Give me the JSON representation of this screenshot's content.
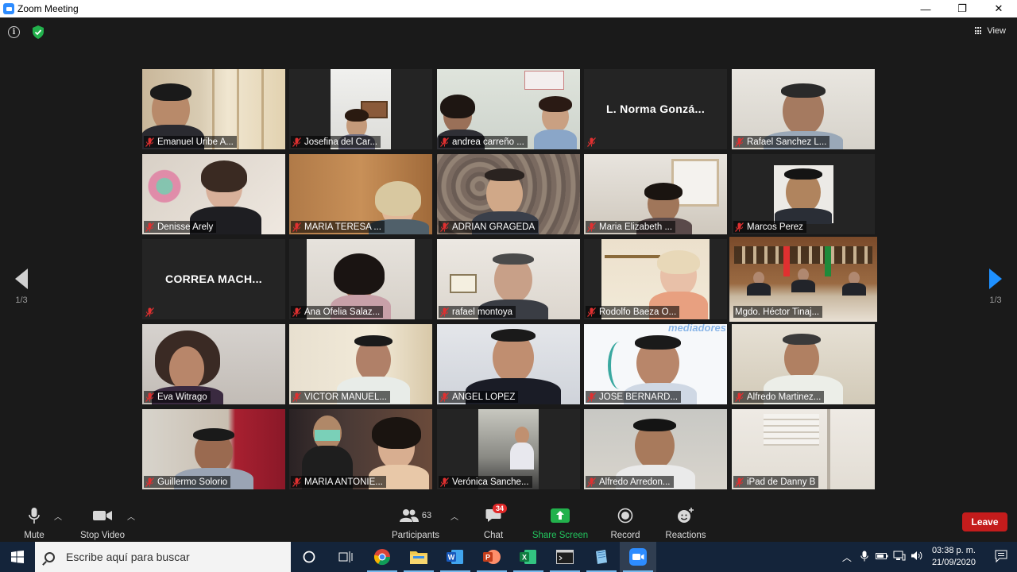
{
  "window": {
    "title": "Zoom Meeting",
    "controls": [
      "—",
      "❐",
      "✕"
    ]
  },
  "meeting": {
    "view_label": "View",
    "page_left": "1/3",
    "page_right": "1/3",
    "participants": [
      "Emanuel Uribe A...",
      "Josefina del Car...",
      "andrea carreño ...",
      "",
      "Rafael Sanchez L...",
      "Denisse Arely",
      "MARIA TERESA ...",
      "ADRIAN GRAGEDA",
      "Maria Elizabeth ...",
      "Marcos Perez",
      "",
      "Ana Ofelia Salaz...",
      "rafael montoya",
      "Rodolfo Baeza O...",
      "Mgdo. Héctor Tinaj...",
      "Eva Witrago",
      "VICTOR MANUEL...",
      "ANGEL LOPEZ",
      "JOSE BERNARD...",
      "Alfredo Martinez...",
      "Guillermo Solorio",
      "MARIA ANTONIE...",
      "Verónica Sanche...",
      "Alfredo Arredon...",
      "iPad de Danny B"
    ],
    "center_names": {
      "tile4": "L. Norma Gonzá...",
      "tile11": "CORREA  MACH..."
    },
    "tile_texts": {
      "mediadores": "mediadores"
    }
  },
  "toolbar": {
    "mute": "Mute",
    "stop_video": "Stop Video",
    "participants": "Participants",
    "participants_count": "63",
    "chat": "Chat",
    "chat_badge": "34",
    "share_screen": "Share Screen",
    "record": "Record",
    "reactions": "Reactions",
    "leave": "Leave"
  },
  "taskbar": {
    "search_placeholder": "Escribe aquí para buscar",
    "time": "03:38 p. m.",
    "date": "21/09/2020"
  },
  "colors": {
    "accent": "#2d8cff",
    "share_green": "#22b14c",
    "leave_red": "#c41c1c",
    "speaker_outline": "#e8f56a"
  }
}
